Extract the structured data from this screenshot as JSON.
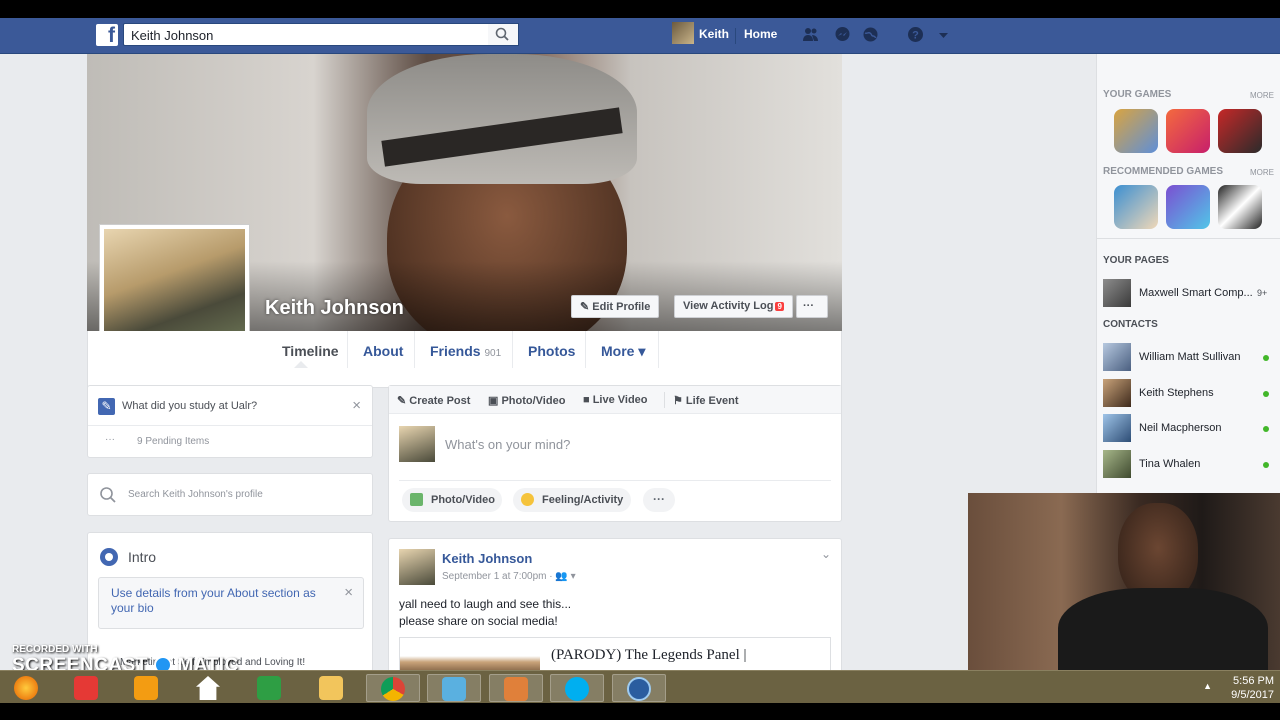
{
  "header": {
    "search_value": "Keith Johnson",
    "user_name": "Keith",
    "home_label": "Home"
  },
  "profile": {
    "name": "Keith Johnson",
    "edit_profile_label": "Edit Profile",
    "activity_log_label": "View Activity Log",
    "activity_log_badge": "9",
    "more_dots": "···"
  },
  "tabs": [
    {
      "label": "Timeline"
    },
    {
      "label": "About"
    },
    {
      "label": "Friends",
      "count": "901"
    },
    {
      "label": "Photos"
    },
    {
      "label": "More ▾"
    }
  ],
  "left": {
    "study_prompt": "What did you study at Ualr?",
    "pending_items": "9 Pending Items",
    "search_placeholder": "Search Keith Johnson's profile",
    "intro_title": "Intro",
    "intro_text": "Use details from your About section as your bio",
    "intro_row": "Marketing at Self Employed and Loving It!"
  },
  "composer": {
    "tabs": [
      "Create Post",
      "Photo/Video",
      "Live Video",
      "Life Event"
    ],
    "placeholder": "What's on your mind?",
    "actions": [
      "Photo/Video",
      "Feeling/Activity",
      "···"
    ]
  },
  "post": {
    "author": "Keith Johnson",
    "time": "September 1 at 7:00pm · ",
    "line1": "yall need to laugh and see this...",
    "line2": "please share on social media!",
    "link_title": "(PARODY) The Legends Panel |"
  },
  "sidebar": {
    "your_games": "YOUR GAMES",
    "more": "MORE",
    "recommended_games": "RECOMMENDED GAMES",
    "your_pages": "YOUR PAGES",
    "page_name": "Maxwell Smart Comp...",
    "page_badge": "9+",
    "contacts_head": "CONTACTS",
    "contacts": [
      "William Matt Sullivan",
      "Keith Stephens",
      "Neil Macpherson",
      "Tina Whalen"
    ],
    "game_colors": [
      "#d9a441",
      "#e23d2e",
      "#c62828",
      "#3c8fd1",
      "#7b4fd1",
      "#222222"
    ]
  },
  "taskbar": {
    "time": "5:56 PM",
    "date": "9/5/2017",
    "tray_arrow": "▲"
  },
  "watermark": {
    "line1": "RECORDED WITH",
    "line2": "SCREENCAST",
    "line3": "MATIC"
  }
}
